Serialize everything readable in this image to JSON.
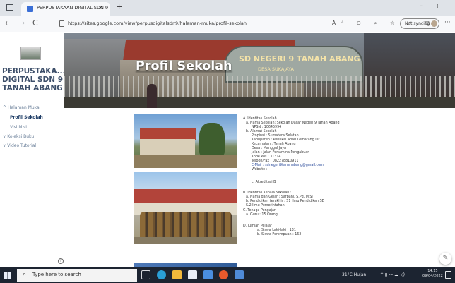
{
  "browser": {
    "tab_title": "PERPUSTAKAAN DIGITAL SDN 9",
    "tab_close": "×",
    "new_tab": "+",
    "url": "https://sites.google.com/view/perpusdigitalsdn9/halaman-muka/profil-sekolah",
    "sync_label": "Not syncing",
    "minimize": "–",
    "maximize": "▢",
    "more": "···",
    "back": "←",
    "forward": "→",
    "reload": "C",
    "toolbar_icons": "Aᴬ ⊙ ⌕ ☆ ✧ ⊞"
  },
  "sidebar": {
    "site_title": "PERPUSTAKA... DIGITAL SDN 9 TANAH ABANG",
    "items": [
      {
        "label": "^ Halaman Muka"
      },
      {
        "label": "Profil Sekolah"
      },
      {
        "label": "Visi Misi"
      },
      {
        "label": "∨ Koleksi Buku"
      },
      {
        "label": "∨ Video Tutorial"
      }
    ],
    "info_icon": "i"
  },
  "banner": {
    "title": "Profil Sekolah",
    "sign_text": "SD NEGERI 9 TANAH ABANG",
    "sign_sub": "DESA SUKAJAYA"
  },
  "profile": {
    "lines": [
      "A. Identitas Sekolah",
      "a. Nama Sekolah: Sekolah Dasar Negeri 9 Tanah Abang",
      "NPSN        : 10645994",
      "b. Alamat Sekolah",
      "Propinsi           : Sumatera Selatan",
      "Kabupaten        : Penukal Abab Lematang Ilir",
      "Kecamatan       : Tanah Abang",
      "Desa                 : Manggul Jaya",
      "Jalan                : Jalan Pertamina Pengabuan",
      "Kode Pos          : 31314",
      "Telpon/Fax       : 082278810911",
      "E-Mail              : sdnegeri9tanahabang@gmail.com",
      "Website            :",
      "",
      "c.    Akreditasi   B",
      "",
      "B. Identitas Kepala Sekolah      :",
      "a. Nama dan Gelar            : Sarbani, S.Pd, M.Si",
      "b. Pendidikan terakhir        : S1 Ilmu Pendidikan SD",
      "                                             S.2 Ilmu Pemerintahan",
      "C. Tenaga Pengajar",
      "a. Guru                              : 15 Orang",
      "",
      "D. Jumlah Pelajar",
      "a.  Siswa Laki-laki    : 131",
      "b.  Siswa Perempuan : 162"
    ]
  },
  "edit_icon": "✎",
  "taskbar": {
    "search_icon": "⌕",
    "search_placeholder": "Type here to search",
    "weather": "31°C  Hujan",
    "tray_icons": "^ ▮ ⊶ ☁ ◁)",
    "time": "14.15",
    "date": "09/04/2022"
  }
}
